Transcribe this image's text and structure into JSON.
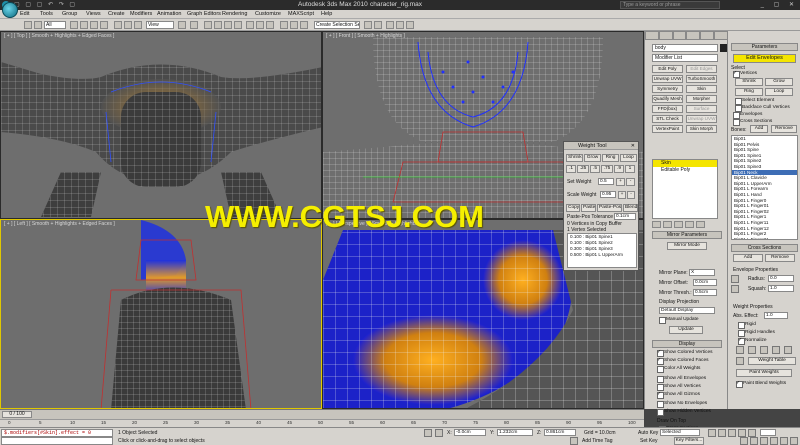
{
  "titlebar": {
    "app": "Autodesk 3ds Max 2010",
    "file": "character_rig.max",
    "search_placeholder": "Type a keyword or phrase"
  },
  "menus": [
    "Edit",
    "Tools",
    "Group",
    "Views",
    "Create",
    "Modifiers",
    "Animation",
    "Graph Editors",
    "Rendering",
    "Customize",
    "MAXScript",
    "Help"
  ],
  "toolbar": {
    "selection_filter": "All",
    "ref_coord": "View",
    "named_selection": "Create Selection Se"
  },
  "viewports": {
    "top": "[ + ] [ Top ] [ Smooth + Highlights + Edged Faces ]",
    "front": "[ + ] [ Front ] [ Smooth + Highlights ]",
    "left": "[ + ] [ Left ] [ Smooth + Highlights + Edged Faces ]",
    "perspective": "[ + ] [ Perspective ] [ Smooth + Highlights ]"
  },
  "weight_tool": {
    "title": "Weight Tool",
    "row1": [
      "Shrink",
      "Grow",
      "Ring",
      "Loop"
    ],
    "row2": [
      ".1",
      ".25",
      ".5",
      ".75",
      ".9",
      "1"
    ],
    "set_weight_label": "Set Weight",
    "set_weight_value": "0.5",
    "scale_weight_label": "Scale Weight",
    "scale_weight_value": "0.95",
    "row3": [
      "Copy",
      "Paste",
      "Paste-Pos",
      "Blend"
    ],
    "tolerance_label": "Paste-Pos Tolerance",
    "tolerance_value": "0.1cm",
    "copy_buffer": "0 Vertices in Copy Buffer",
    "selected": "1 Vertex Selected",
    "weights": [
      "0.100 : Bip01 Spine1",
      "0.100 : Bip01 Spine2",
      "0.300 : Bip01 Spine3",
      "0.500 : Bip01 L UpperArm"
    ]
  },
  "modifier_panel": {
    "object_name": "body",
    "object_color": "#222222",
    "modifier_list": "Modifier List",
    "buttons": [
      {
        "label": "Edit Poly",
        "disabled": false
      },
      {
        "label": "Edit Edges",
        "disabled": true
      },
      {
        "label": "Unwrap UVW",
        "disabled": false
      },
      {
        "label": "TurboSmooth",
        "disabled": false
      },
      {
        "label": "Symmetry",
        "disabled": false
      },
      {
        "label": "Skin",
        "disabled": false
      },
      {
        "label": "Quadify Mesh",
        "disabled": false
      },
      {
        "label": "Morpher",
        "disabled": false
      },
      {
        "label": "FFD(box)",
        "disabled": false
      },
      {
        "label": "Surface",
        "disabled": true
      },
      {
        "label": "STL Check",
        "disabled": false
      },
      {
        "label": "Unwrap UVW",
        "disabled": true
      },
      {
        "label": "VertexPaint",
        "disabled": false
      },
      {
        "label": "Skin Morph",
        "disabled": false
      }
    ],
    "stack": [
      {
        "label": "Skin",
        "active": true
      },
      {
        "label": "Editable Poly",
        "active": false
      }
    ],
    "mirror_rollout": "Mirror Parameters",
    "mirror_mode": "Mirror Mode",
    "mirror_plane_label": "Mirror Plane:",
    "mirror_plane_value": "X",
    "mirror_offset_label": "Mirror Offset:",
    "mirror_offset_value": "0.0cm",
    "mirror_thresh_label": "Mirror Thresh.:",
    "mirror_thresh_value": "0.5cm",
    "display_projection_label": "Display Projection",
    "display_projection_value": "Default Display",
    "manual_update": "Manual Update",
    "update": "Update",
    "display_rollout": "Display",
    "display_checks": [
      {
        "label": "Show Colored Vertices",
        "on": true
      },
      {
        "label": "Show Colored Faces",
        "on": true
      },
      {
        "label": "Color All Weights",
        "on": false
      },
      {
        "label": "Show All Envelopes",
        "on": false
      },
      {
        "label": "Show All Vertices",
        "on": false
      },
      {
        "label": "Show All Gizmos",
        "on": true
      },
      {
        "label": "Show No Envelopes",
        "on": false
      },
      {
        "label": "Show Hidden Vertices",
        "on": false
      }
    ],
    "draw_on_top": "Draw On Top",
    "draw_checks": [
      {
        "label": "Cross Sections",
        "on": false
      },
      {
        "label": "Envelopes",
        "on": false
      }
    ],
    "advanced_rollout": "Advanced Parameters"
  },
  "parameters_panel": {
    "header": "Parameters",
    "edit_envelopes": "Edit Envelopes",
    "select_label": "Select",
    "vertices": "Vertices",
    "shrink": "Shrink",
    "grow": "Grow",
    "ring": "Ring",
    "loop": "Loop",
    "select_element": "Select Element",
    "backface_cull": "Backface Cull Vertices",
    "envelopes": "Envelopes",
    "cross_sections": "Cross Sections",
    "bones_label": "Bones:",
    "add": "Add",
    "remove": "Remove",
    "bones": [
      "Bip01",
      "Bip01 Pelvis",
      "Bip01 Spine",
      "Bip01 Spine1",
      "Bip01 Spine2",
      "Bip01 Spine3",
      "Bip01 Neck",
      "Bip01 L Clavicle",
      "Bip01 L UpperArm",
      "Bip01 L Forearm",
      "Bip01 L Hand",
      "Bip01 L Finger0",
      "Bip01 L Finger01",
      "Bip01 L Finger02",
      "Bip01 L Finger1",
      "Bip01 L Finger11",
      "Bip01 L Finger12",
      "Bip01 L Finger2",
      "Bip01 L Finger21",
      "Bip01 L Finger22",
      "Bip01 L Finger3",
      "Bip01 L Finger31"
    ],
    "selected_bone": "Bip01 Neck",
    "cross_sections_header": "Cross Sections",
    "cs_add": "Add",
    "cs_remove": "Remove",
    "env_props": "Envelope Properties",
    "radius_label": "Radius:",
    "radius_value": "0.0",
    "squash_label": "Squash:",
    "squash_value": "1.0",
    "weight_props": "Weight Properties",
    "abs_effect_label": "Abs. Effect:",
    "abs_effect_value": "1.0",
    "rigid": "Rigid",
    "rigid_handles": "Rigid Handles",
    "normalize": "Normalize",
    "weight_table": "Weight Table",
    "paint_weights": "Paint Weights",
    "paint_blend": "Paint Blend Weights"
  },
  "timeline": {
    "slider": "0 / 100",
    "ticks": [
      "0",
      "5",
      "10",
      "15",
      "20",
      "25",
      "30",
      "35",
      "40",
      "45",
      "50",
      "55",
      "60",
      "65",
      "70",
      "75",
      "80",
      "85",
      "90",
      "95",
      "100"
    ]
  },
  "status": {
    "maxscript": "$.modifiers[#Skin].effect = 0",
    "selected": "1 Object Selected",
    "prompt": "Click or click-and-drag to select objects",
    "x_label": "X:",
    "x_value": "-0.0cm",
    "y_label": "Y:",
    "y_value": "1.232cm",
    "z_label": "Z:",
    "z_value": "0.861cm",
    "grid": "Grid = 10.0cm",
    "add_time_tag": "Add Time Tag",
    "auto_key": "Auto Key",
    "set_key": "Set Key",
    "selected_dd": "Selected",
    "key_filters": "Key Filters..."
  },
  "watermark": "WWW.CGTSJ.COM"
}
